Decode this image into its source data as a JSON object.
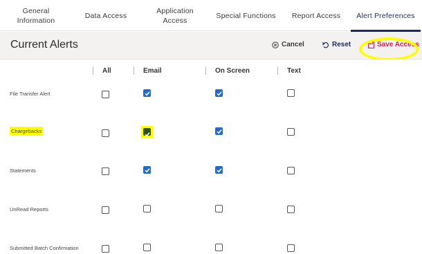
{
  "tabs": [
    {
      "label": "General Information"
    },
    {
      "label": "Data Access"
    },
    {
      "label": "Application Access"
    },
    {
      "label": "Special Functions"
    },
    {
      "label": "Report Access"
    },
    {
      "label": "Alert Preferences"
    }
  ],
  "active_tab": "Alert Preferences",
  "header": {
    "title": "Current Alerts",
    "cancel_label": "Cancel",
    "reset_label": "Reset",
    "save_label": "Save Access"
  },
  "columns": {
    "all": "All",
    "email": "Email",
    "on_screen": "On Screen",
    "text": "Text"
  },
  "alerts": [
    {
      "label": "File Transfer Alert",
      "all": false,
      "email": true,
      "on_screen": true,
      "text": false
    },
    {
      "label": "Chargebacks",
      "all": false,
      "email": true,
      "on_screen": true,
      "text": false
    },
    {
      "label": "Statements",
      "all": false,
      "email": true,
      "on_screen": true,
      "text": false
    },
    {
      "label": "UnRead Reports",
      "all": false,
      "email": false,
      "on_screen": false,
      "text": false
    },
    {
      "label": "Submitted Batch Confirmation",
      "all": false,
      "email": false,
      "on_screen": false,
      "text": false
    }
  ],
  "colors": {
    "accent": "#1d2a5c",
    "checkbox_checked": "#1f6bd0",
    "save": "#c7254e",
    "highlight": "#ffff00"
  }
}
